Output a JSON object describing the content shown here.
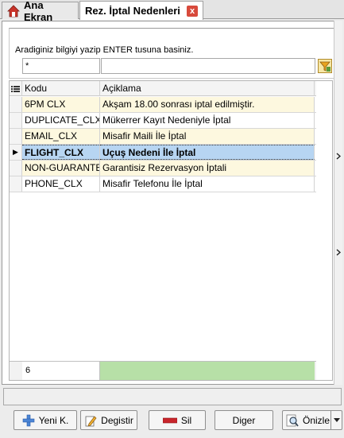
{
  "tabs": [
    {
      "label": "Ana Ekran"
    },
    {
      "label": "Rez. İptal Nedenleri",
      "close": "x"
    }
  ],
  "search": {
    "hint": "Aradiginiz bilgiyi yazip ENTER tusuna basiniz.",
    "filter_value": "*",
    "query_value": ""
  },
  "grid": {
    "columns": [
      "Kodu",
      "Açiklama"
    ],
    "rows": [
      {
        "code": "6PM CLX",
        "desc": "Akşam 18.00 sonrası iptal edilmiştir."
      },
      {
        "code": "DUPLICATE_CLX",
        "desc": "Mükerrer Kayıt Nedeniyle İptal"
      },
      {
        "code": "EMAIL_CLX",
        "desc": "Misafir Maili İle İptal"
      },
      {
        "code": "FLIGHT_CLX",
        "desc": "Uçuş Nedeni İle İptal",
        "selected": true
      },
      {
        "code": "NON-GUARANTEE",
        "desc": "Garantisiz Rezervasyon İptali"
      },
      {
        "code": "PHONE_CLX",
        "desc": "Misafir Telefonu İle İptal"
      }
    ],
    "row_count": "6",
    "selected_marker": "▶"
  },
  "buttons": {
    "new": "Yeni K.",
    "edit": "Degistir",
    "delete": "Sil",
    "other": "Diger",
    "preview": "Önizle"
  },
  "icons": {
    "home": "home-icon",
    "filter": "filter-icon",
    "grid_menu": "grid-menu-icon",
    "new": "plus-icon",
    "edit": "pencil-icon",
    "delete": "minus-icon",
    "preview": "magnifier-icon"
  },
  "colors": {
    "odd_row": "#fdf8df",
    "selected_row": "#b7d5f2",
    "footer_bar": "#b7e0a7"
  }
}
